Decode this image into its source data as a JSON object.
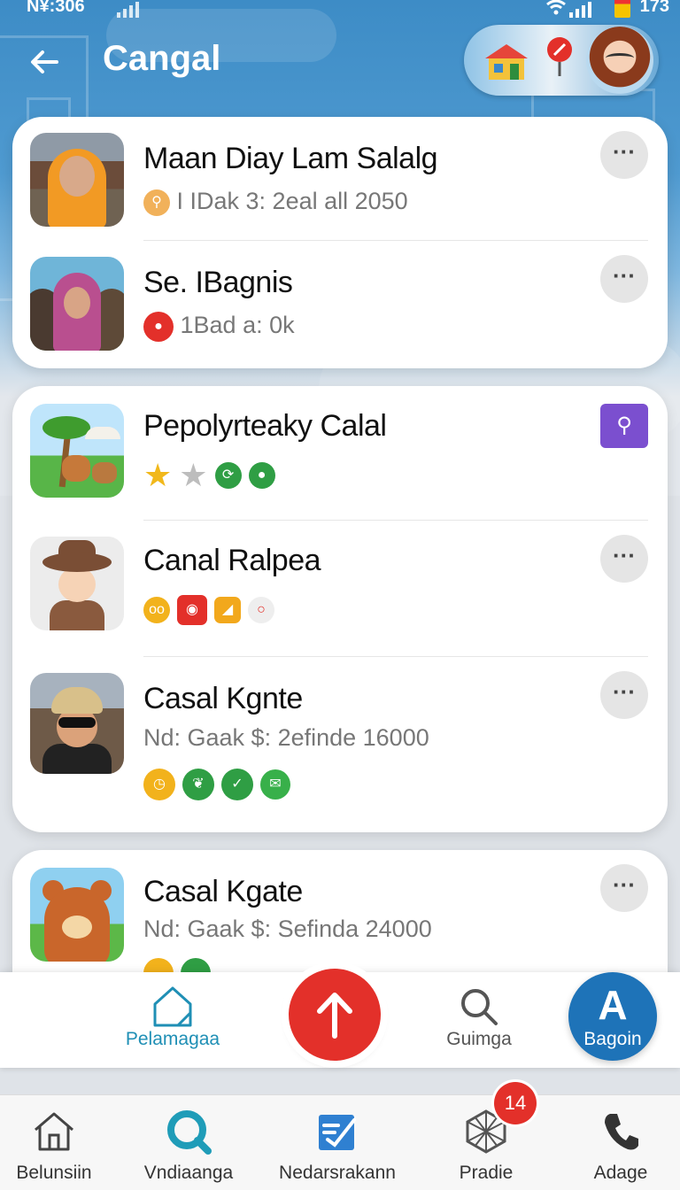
{
  "status_bar": {
    "left_text": "N¥:306",
    "right_text": "173"
  },
  "header": {
    "title": "Cangal",
    "back_icon": "arrow-left-icon"
  },
  "cards": [
    {
      "rows": [
        {
          "name": "Maan Diay Lam Salalg",
          "subtitle": "I IDak 3: 2eal all 2050",
          "sub_icon": "search-coin-icon"
        },
        {
          "name": "Se. IBagnis",
          "subtitle": "1Bad a: 0k",
          "sub_icon": "red-pin-icon"
        }
      ]
    },
    {
      "rows": [
        {
          "name": "Pepolyrteaky Calal",
          "badges": [
            "star-icon",
            "star-outline-icon",
            "refresh-icon",
            "dot-icon"
          ]
        },
        {
          "name": "Canal Ralpea",
          "badges": [
            "glasses-icon",
            "camera-icon",
            "bookmark-icon",
            "ring-icon"
          ]
        },
        {
          "name": "Casal Kgnte",
          "subtitle": "Nd: Gaak $: 2efinde 16000",
          "badges": [
            "clock-icon",
            "leaf-icon",
            "check-icon",
            "mail-icon"
          ]
        }
      ]
    },
    {
      "rows": [
        {
          "name": "Casal Kgate",
          "subtitle": "Nd: Gaak $: Sefinda 24000"
        }
      ]
    }
  ],
  "action_bar": {
    "home_label": "Pelamagaa",
    "search_label": "Guimga",
    "profile_label": "Bagoin",
    "profile_glyph": "A"
  },
  "bottom_nav": {
    "items": [
      {
        "label": "Belunsiin",
        "icon": "house-icon"
      },
      {
        "label": "Vndiaanga",
        "icon": "search-icon"
      },
      {
        "label": "Nedarsrakann",
        "icon": "edit-checkbox-icon"
      },
      {
        "label": "Pradie",
        "icon": "globe-grid-icon",
        "badge": "14"
      },
      {
        "label": "Adage",
        "icon": "phone-icon"
      }
    ]
  },
  "colors": {
    "accent_red": "#e3302a",
    "accent_blue": "#1e73b8",
    "teal": "#1f8fb5",
    "header_blue": "#3d8cc6"
  }
}
